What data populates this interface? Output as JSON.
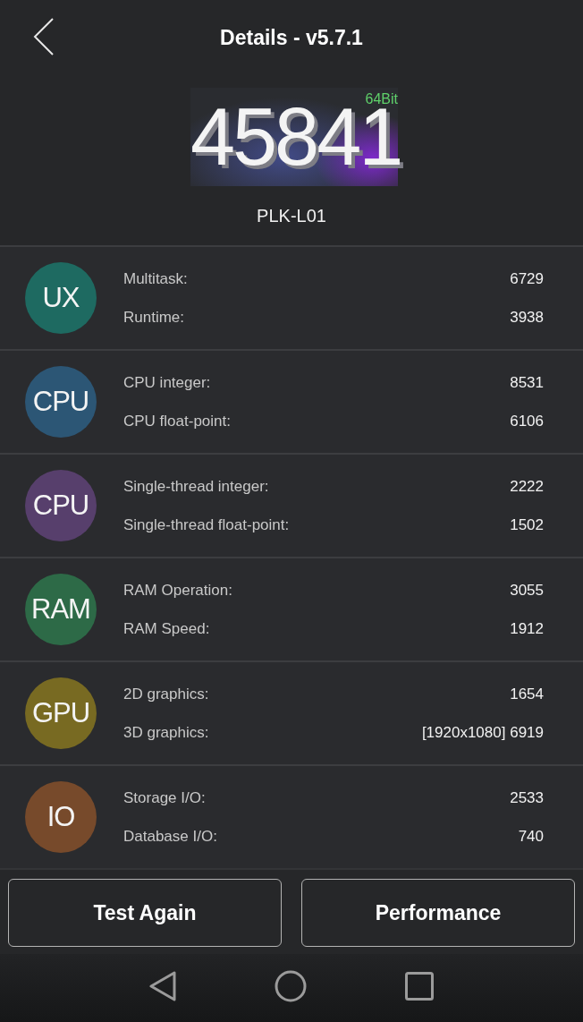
{
  "header": {
    "title": "Details - v5.7.1"
  },
  "score": {
    "value": "45841",
    "badge": "64Bit",
    "device": "PLK-L01"
  },
  "categories": [
    {
      "label": "UX",
      "color": "#1e6a61",
      "metrics": [
        {
          "name": "Multitask:",
          "value": "6729"
        },
        {
          "name": "Runtime:",
          "value": "3938"
        }
      ]
    },
    {
      "label": "CPU",
      "color": "#2c5675",
      "metrics": [
        {
          "name": "CPU integer:",
          "value": "8531"
        },
        {
          "name": "CPU float-point:",
          "value": "6106"
        }
      ]
    },
    {
      "label": "CPU",
      "color": "#573f6c",
      "metrics": [
        {
          "name": "Single-thread integer:",
          "value": "2222"
        },
        {
          "name": "Single-thread float-point:",
          "value": "1502"
        }
      ]
    },
    {
      "label": "RAM",
      "color": "#2d6a47",
      "metrics": [
        {
          "name": "RAM Operation:",
          "value": "3055"
        },
        {
          "name": "RAM Speed:",
          "value": "1912"
        }
      ]
    },
    {
      "label": "GPU",
      "color": "#786a22",
      "metrics": [
        {
          "name": "2D graphics:",
          "value": "1654"
        },
        {
          "name": "3D graphics:",
          "value": "[1920x1080] 6919"
        }
      ]
    },
    {
      "label": "IO",
      "color": "#774a2b",
      "metrics": [
        {
          "name": "Storage I/O:",
          "value": "2533"
        },
        {
          "name": "Database I/O:",
          "value": "740"
        }
      ]
    }
  ],
  "buttons": [
    "Test Again",
    "Performance"
  ]
}
